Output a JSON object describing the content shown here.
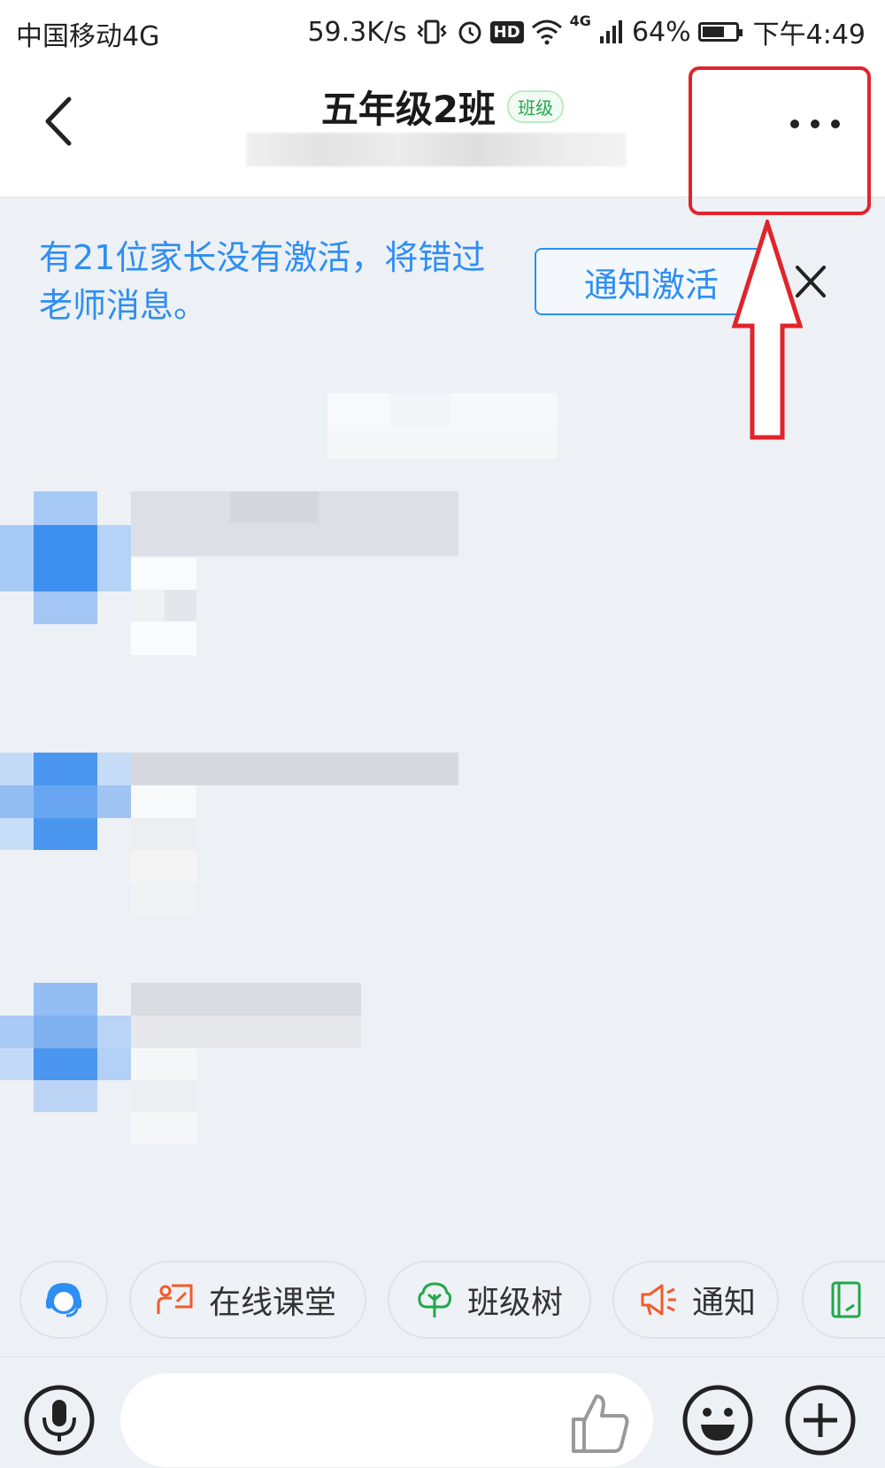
{
  "status_bar": {
    "carrier": "中国移动4G",
    "speed": "59.3K/s",
    "hd_badge": "HD",
    "network": "4G",
    "battery": "64%",
    "battery_level": 0.64,
    "time": "下午4:49"
  },
  "header": {
    "title": "五年级2班",
    "badge": "班级"
  },
  "banner": {
    "message": "有21位家长没有激活，将错过老师消息。",
    "button": "通知激活"
  },
  "quick_actions": [
    {
      "label": ""
    },
    {
      "label": "在线课堂"
    },
    {
      "label": "班级树"
    },
    {
      "label": "通知"
    },
    {
      "label": ""
    }
  ],
  "colors": {
    "accent_blue": "#2d8ef4",
    "badge_green": "#20a84a",
    "annotation_red": "#e0242c",
    "background": "#edf0f4"
  },
  "icons": [
    "back-icon",
    "more-icon",
    "close-icon",
    "customer-service-icon",
    "online-class-icon",
    "class-tree-icon",
    "notice-icon",
    "homework-icon",
    "mic-icon",
    "thumbs-up-icon",
    "emoji-icon",
    "plus-icon"
  ]
}
